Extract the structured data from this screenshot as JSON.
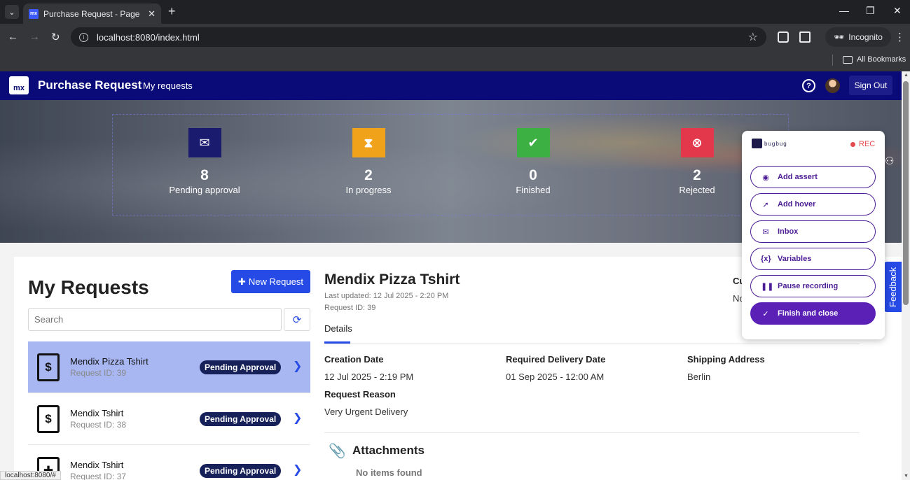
{
  "browser": {
    "tab_title": "Purchase Request - Page",
    "favicon_text": "mx",
    "url": "localhost:8080/index.html",
    "incognito_label": "Incognito",
    "bookmarks_label": "All Bookmarks",
    "status_url": "localhost:8080/#"
  },
  "navbar": {
    "logo_text": "mx",
    "app_title": "Purchase Request",
    "my_requests_link": "My requests",
    "help_symbol": "?",
    "signout_label": "Sign Out",
    "color": "#0a0a78"
  },
  "stats": [
    {
      "count": "8",
      "label": "Pending approval",
      "icon": "envelope-icon",
      "color": "#1a1a6e"
    },
    {
      "count": "2",
      "label": "In progress",
      "icon": "hourglass-icon",
      "color": "#f0a21b"
    },
    {
      "count": "0",
      "label": "Finished",
      "icon": "check-circle-icon",
      "color": "#3cb043"
    },
    {
      "count": "2",
      "label": "Rejected",
      "icon": "x-circle-icon",
      "color": "#e3374b"
    }
  ],
  "list": {
    "title": "My Requests",
    "new_request_label": "New Request",
    "search_placeholder": "Search",
    "requests": [
      {
        "name": "Mendix Pizza Tshirt",
        "id": "Request ID: 39",
        "status": "Pending Approval",
        "selected": true
      },
      {
        "name": "Mendix Tshirt",
        "id": "Request ID: 38",
        "status": "Pending Approval",
        "selected": false
      },
      {
        "name": "Mendix Tshirt",
        "id": "Request ID: 37",
        "status": "Pending Approval",
        "selected": false
      }
    ]
  },
  "detail": {
    "title": "Mendix Pizza Tshirt",
    "last_updated": "Last updated: 12 Jul 2025 - 2:20 PM",
    "request_id": "Request ID: 39",
    "tab": "Details",
    "fields": {
      "creation_date_label": "Creation Date",
      "creation_date_value": "12 Jul 2025 - 2:19 PM",
      "delivery_label": "Required Delivery Date",
      "delivery_value": "01 Sep 2025 - 12:00 AM",
      "shipping_label": "Shipping Address",
      "shipping_value": "Berlin",
      "reason_label": "Request Reason",
      "reason_value": "Very Urgent Delivery"
    },
    "cut_label": "Cu",
    "cut_value": "No",
    "attachments_title": "Attachments",
    "no_items": "No items found"
  },
  "feedback_label": "Feedback",
  "bugbug": {
    "logo_text": "bugbug",
    "rec_label": "REC",
    "buttons": [
      {
        "label": "Add assert",
        "icon": "eye-icon"
      },
      {
        "label": "Add hover",
        "icon": "cursor-icon"
      },
      {
        "label": "Inbox",
        "icon": "mail-icon"
      },
      {
        "label": "Variables",
        "icon": "variables-icon"
      },
      {
        "label": "Pause recording",
        "icon": "pause-icon"
      },
      {
        "label": "Finish and close",
        "icon": "check-icon"
      }
    ]
  }
}
